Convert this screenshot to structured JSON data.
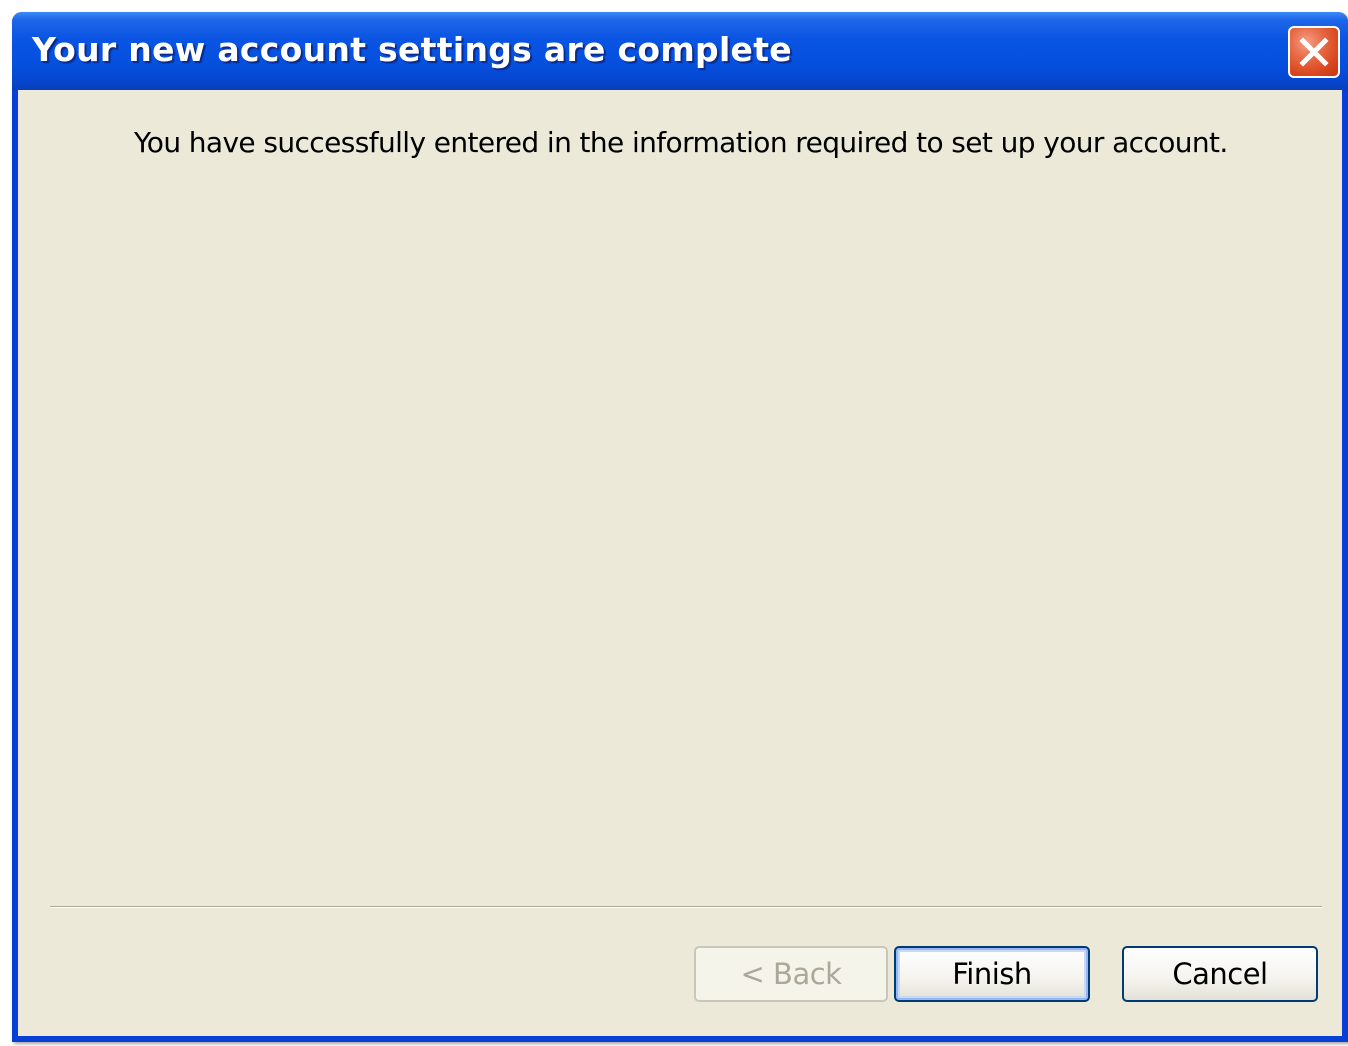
{
  "window": {
    "title": "Your new account settings are complete",
    "close_icon": "close-icon"
  },
  "content": {
    "message": "You have successfully entered in the information required to set up your account."
  },
  "buttons": {
    "back_label": "< Back",
    "back_enabled": false,
    "finish_label": "Finish",
    "finish_default": true,
    "cancel_label": "Cancel"
  },
  "colors": {
    "titlebar": "#0a54e3",
    "client_background": "#ece9d8",
    "close_button": "#d9471f"
  }
}
